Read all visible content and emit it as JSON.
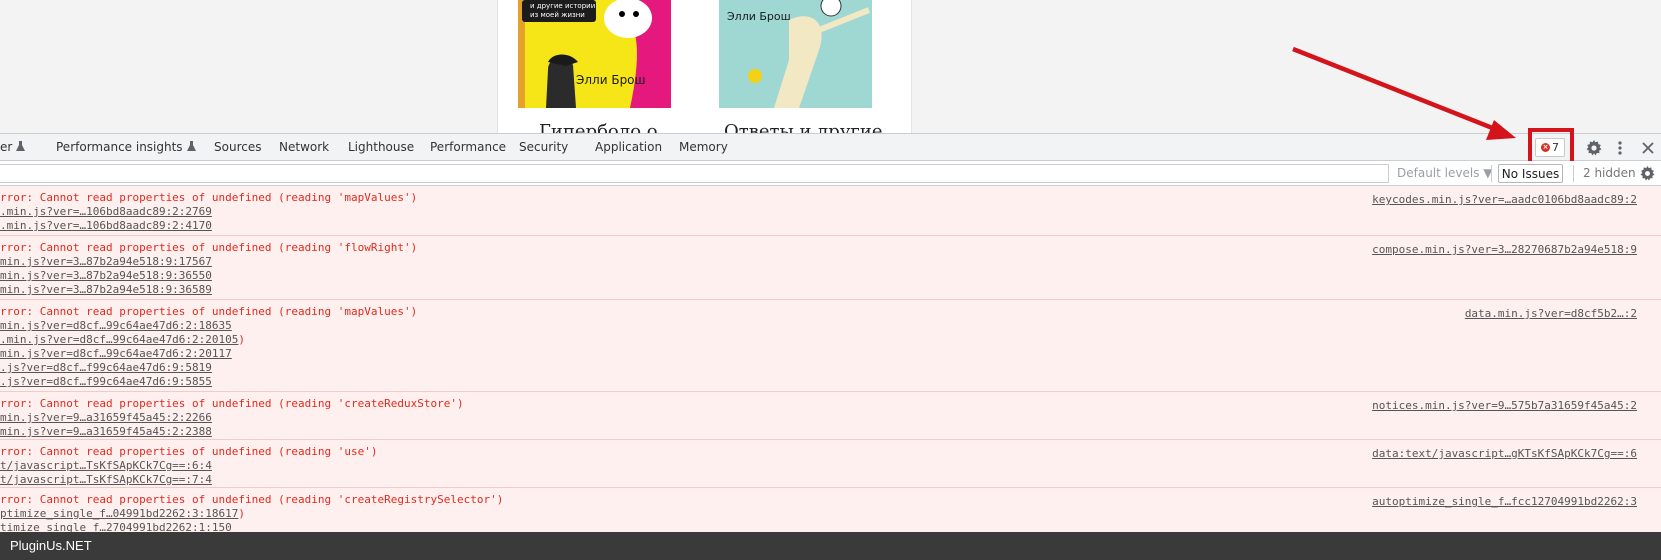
{
  "page": {
    "book1": {
      "cover_lines": [
        "и другие истории",
        "из моей жизни"
      ],
      "author": "Элли Брош",
      "title": "Гиперболо о"
    },
    "book2": {
      "author": "Элли Брош",
      "title": "Ответы и другие"
    }
  },
  "devtools": {
    "tabs": [
      "er",
      "Performance insights",
      "Sources",
      "Network",
      "Lighthouse",
      "Performance",
      "Security",
      "Application",
      "Memory"
    ],
    "issues_count": "7",
    "toolbar": {
      "filter_placeholder": "",
      "levels_label": "Default levels ▼",
      "no_issues_label": "No Issues",
      "hidden_label": "2 hidden"
    },
    "messages": [
      {
        "text": "rror: Cannot read properties of undefined (reading 'mapValues')",
        "source": "keycodes.min.js?ver=…aadc0106bd8aadc89:2",
        "stack": [
          ".min.js?ver=…106bd8aadc89:2:2769",
          ".min.js?ver=…106bd8aadc89:2:4170"
        ]
      },
      {
        "text": "rror: Cannot read properties of undefined (reading 'flowRight')",
        "source": "compose.min.js?ver=3…28270687b2a94e518:9",
        "stack": [
          "min.js?ver=3…87b2a94e518:9:17567",
          "min.js?ver=3…87b2a94e518:9:36550",
          "min.js?ver=3…87b2a94e518:9:36589"
        ]
      },
      {
        "text": "rror: Cannot read properties of undefined (reading 'mapValues')",
        "source": "data.min.js?ver=d8cf5b2…:2",
        "stack": [
          "min.js?ver=d8cf…99c64ae47d6:2:18635",
          ".min.js?ver=d8cf…99c64ae47d6:2:20105",
          "min.js?ver=d8cf…99c64ae47d6:2:20117",
          ".js?ver=d8cf…f99c64ae47d6:9:5819",
          ".js?ver=d8cf…f99c64ae47d6:9:5855"
        ]
      },
      {
        "text": "rror: Cannot read properties of undefined (reading 'createReduxStore')",
        "source": "notices.min.js?ver=9…575b7a31659f45a45:2",
        "stack": [
          "min.js?ver=9…a31659f45a45:2:2266",
          "min.js?ver=9…a31659f45a45:2:2388"
        ]
      },
      {
        "text": "rror: Cannot read properties of undefined (reading 'use')",
        "source": "data:text/javascript…gKTsKfSApKCk7Cg==:6",
        "stack": [
          "t/javascript…TsKfSApKCk7Cg==:6:4",
          "t/javascript…TsKfSApKCk7Cg==:7:4"
        ]
      },
      {
        "text": "rror: Cannot read properties of undefined (reading 'createRegistrySelector')",
        "source": "autoptimize_single_f…fcc12704991bd2262:3",
        "stack": [
          "ptimize_single_f…04991bd2262:3:18617",
          "timize_single_f…2704991bd2262:1:150"
        ]
      }
    ]
  },
  "footer": {
    "brand": "PluginUs.NET"
  },
  "colors": {
    "error_text": "#e22a1e",
    "error_bg": "#fff0f0",
    "annotation": "#d4131b"
  }
}
